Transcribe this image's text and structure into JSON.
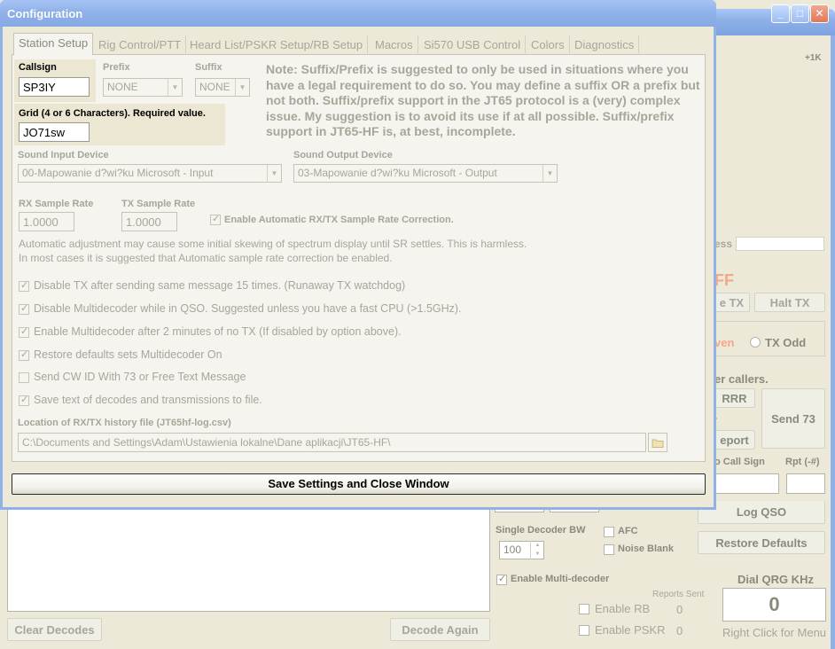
{
  "dialog": {
    "title": "Configuration",
    "tabs": [
      {
        "label": "Station Setup"
      },
      {
        "label": "Rig Control/PTT"
      },
      {
        "label": "Heard List/PSKR Setup/RB Setup"
      },
      {
        "label": "Macros"
      },
      {
        "label": "Si570 USB Control"
      },
      {
        "label": "Colors"
      },
      {
        "label": "Diagnostics"
      }
    ],
    "callsign": {
      "label": "Callsign",
      "value": "SP3IY"
    },
    "prefix": {
      "label": "Prefix",
      "value": "NONE"
    },
    "suffix": {
      "label": "Suffix",
      "value": "NONE"
    },
    "grid": {
      "label": "Grid (4 or 6 Characters).  Required value.",
      "value": "JO71sw"
    },
    "note": "Note:  Suffix/Prefix is suggested to only be used in situations where you have a legal requirement to do so.  You may define a suffix OR a prefix but not both.  Suffix/prefix support in the JT65 protocol is a (very) complex issue.  My suggestion is to avoid its use if at all possible.  Suffix/prefix support in JT65-HF is, at best, incomplete.",
    "sound_input": {
      "label": "Sound Input Device",
      "value": "00-Mapowanie d?wi?ku Microsoft - Input"
    },
    "sound_output": {
      "label": "Sound Output Device",
      "value": "03-Mapowanie d?wi?ku Microsoft - Output"
    },
    "rx_rate": {
      "label": "RX Sample Rate",
      "value": "1.0000"
    },
    "tx_rate": {
      "label": "TX Sample Rate",
      "value": "1.0000"
    },
    "auto_correction": {
      "label": "Enable Automatic RX/TX Sample Rate Correction.",
      "checked": true
    },
    "auto_text_1": "Automatic adjustment may cause some initial skewing of spectrum display until SR settles.  This is harmless.",
    "auto_text_2": "In most cases it is suggested that Automatic sample rate correction be enabled.",
    "options": [
      {
        "label": "Disable TX after sending same message 15 times. (Runaway TX watchdog)",
        "checked": true
      },
      {
        "label": "Disable Multidecoder while in QSO.  Suggested unless you have a fast CPU (>1.5GHz).",
        "checked": true
      },
      {
        "label": "Enable Multidecoder after 2 minutes of no TX (If disabled by option above).",
        "checked": true
      },
      {
        "label": "Restore defaults sets Multidecoder On",
        "checked": true
      },
      {
        "label": "Send CW ID With 73 or Free Text Message",
        "checked": false
      },
      {
        "label": "Save text of decodes and transmissions to file.",
        "checked": true
      }
    ],
    "log_location": {
      "label": "Location of RX/TX history file (JT65hf-log.csv)",
      "value": "C:\\Documents and Settings\\Adam\\Ustawienia lokalne\\Dane aplikacji\\JT65-HF\\"
    },
    "save_button": "Save Settings and Close Window"
  },
  "main": {
    "window_buttons": {
      "minimize": "_",
      "maximize": "□",
      "close": "✕"
    },
    "plus1k": "+1K",
    "ess_fragment": "ess",
    "ff_fragment": "FF",
    "e_tx": "e TX",
    "halt_tx": "Halt TX",
    "even": "ven",
    "tx_odd": "TX Odd",
    "er_callers": "er callers.",
    "rrr": "RRR",
    "dot": ".",
    "eport": "eport",
    "send73": "Send 73",
    "o_call_sign": "o Call Sign",
    "rpt": "Rpt (-#)",
    "log_qso": "Log QSO",
    "single_decoder_bw": "Single Decoder BW",
    "bw_value": "100",
    "afc": {
      "label": "AFC",
      "checked": false
    },
    "noise_blank": {
      "label": "Noise Blank",
      "checked": false
    },
    "restore_defaults": "Restore Defaults",
    "enable_multidecoder": {
      "label": "Enable Multi-decoder",
      "checked": true
    },
    "dial_qrg_label": "Dial QRG KHz",
    "dial_qrg_value": "0",
    "reports_sent": "Reports Sent",
    "enable_rb": {
      "label": "Enable RB",
      "checked": false,
      "count": "0"
    },
    "enable_pskr": {
      "label": "Enable PSKR",
      "checked": false,
      "count": "0"
    },
    "right_click": "Right Click for Menu",
    "clear_decodes": "Clear Decodes",
    "decode_again": "Decode Again"
  },
  "colors": {
    "titlebar": "#8fb1e8",
    "halt_text": "#f4a78a",
    "disabled_text": "#a7a69a"
  }
}
